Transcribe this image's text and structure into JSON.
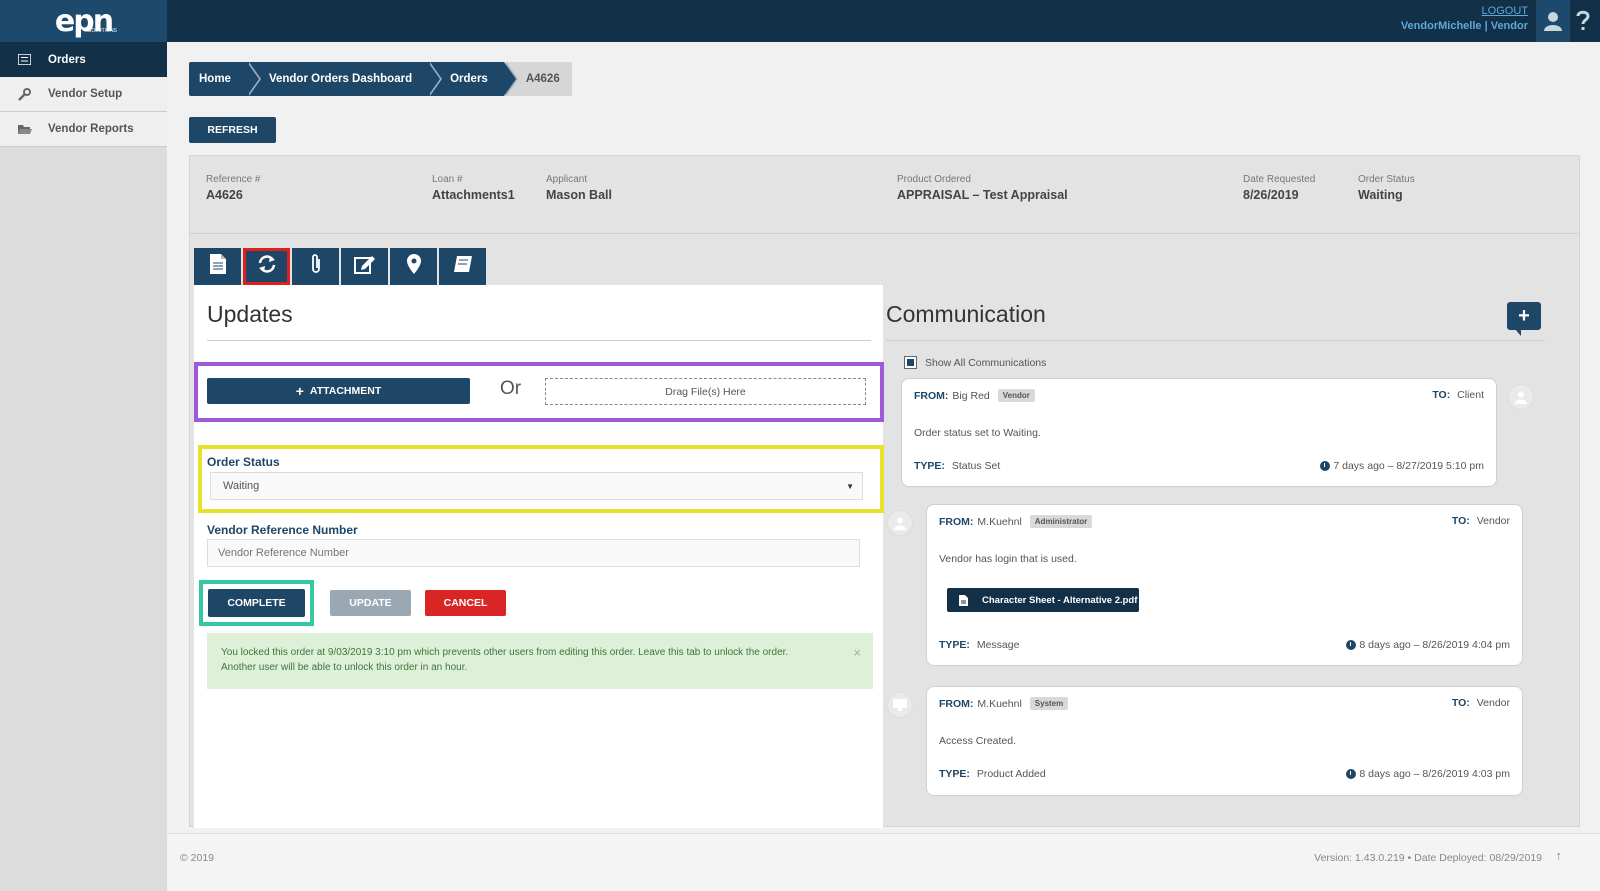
{
  "header": {
    "logo_text": "epn",
    "logo_sub": "SOLUTIONS",
    "logout": "LOGOUT",
    "user_name": "VendorMichelle | Vendor"
  },
  "sidebar": {
    "items": [
      {
        "label": "Orders",
        "icon": "list-icon",
        "active": true
      },
      {
        "label": "Vendor Setup",
        "icon": "wrench-icon",
        "active": false
      },
      {
        "label": "Vendor Reports",
        "icon": "folder-open-icon",
        "active": false
      }
    ]
  },
  "breadcrumb": [
    "Home",
    "Vendor Orders Dashboard",
    "Orders",
    "A4626"
  ],
  "toolbar": {
    "refresh_label": "REFRESH"
  },
  "order_info": {
    "reference": {
      "label": "Reference #",
      "value": "A4626"
    },
    "loan": {
      "label": "Loan #",
      "value": "Attachments1"
    },
    "applicant": {
      "label": "Applicant",
      "value": "Mason Ball"
    },
    "product": {
      "label": "Product Ordered",
      "value": "APPRAISAL – Test Appraisal"
    },
    "date_requested": {
      "label": "Date Requested",
      "value": "8/26/2019"
    },
    "order_status": {
      "label": "Order Status",
      "value": "Waiting"
    }
  },
  "tabs": [
    {
      "icon": "document-icon",
      "active": false
    },
    {
      "icon": "refresh-icon",
      "active": true
    },
    {
      "icon": "paperclip-icon",
      "active": false
    },
    {
      "icon": "edit-icon",
      "active": false
    },
    {
      "icon": "map-marker-icon",
      "active": false
    },
    {
      "icon": "book-icon",
      "active": false
    }
  ],
  "updates": {
    "title": "Updates",
    "attachment_label": "ATTACHMENT",
    "or_text": "Or",
    "drop_text": "Drag File(s) Here",
    "status_label": "Order Status",
    "status_value": "Waiting",
    "vendor_ref_label": "Vendor Reference Number",
    "vendor_ref_placeholder": "Vendor Reference Number",
    "complete_label": "COMPLETE",
    "update_label": "UPDATE",
    "cancel_label": "CANCEL",
    "alert_text": "You locked this order at 9/03/2019 3:10 pm which prevents other users from editing this order. Leave this tab to unlock the order. Another user will be able to unlock this order in an hour.",
    "alert_close": "×",
    "highlight_colors": {
      "tab": "#e0201f",
      "attachment": "#a259d9",
      "status": "#e8e22c",
      "complete": "#36c7a4"
    }
  },
  "communication": {
    "title": "Communication",
    "show_all_label": "Show All Communications",
    "messages": [
      {
        "from_label": "FROM:",
        "from": "Big Red",
        "role": "Vendor",
        "to_label": "TO:",
        "to": "Client",
        "body": "Order status set to Waiting.",
        "type_label": "TYPE:",
        "type": "Status Set",
        "time": "7 days ago – 8/27/2019 5:10 pm"
      },
      {
        "from_label": "FROM:",
        "from": "M.Kuehnl",
        "role": "Administrator",
        "to_label": "TO:",
        "to": "Vendor",
        "body": "Vendor has login that is used.",
        "attachment": "Character Sheet - Alternative 2.pdf",
        "type_label": "TYPE:",
        "type": "Message",
        "time": "8 days ago – 8/26/2019 4:04 pm"
      },
      {
        "from_label": "FROM:",
        "from": "M.Kuehnl",
        "role": "System",
        "to_label": "TO:",
        "to": "Vendor",
        "body": "Access Created.",
        "type_label": "TYPE:",
        "type": "Product Added",
        "time": "8 days ago – 8/26/2019 4:03 pm"
      }
    ]
  },
  "footer": {
    "copyright": "© 2019",
    "version": "Version: 1.43.0.219  •  Date Deployed: 08/29/2019"
  }
}
